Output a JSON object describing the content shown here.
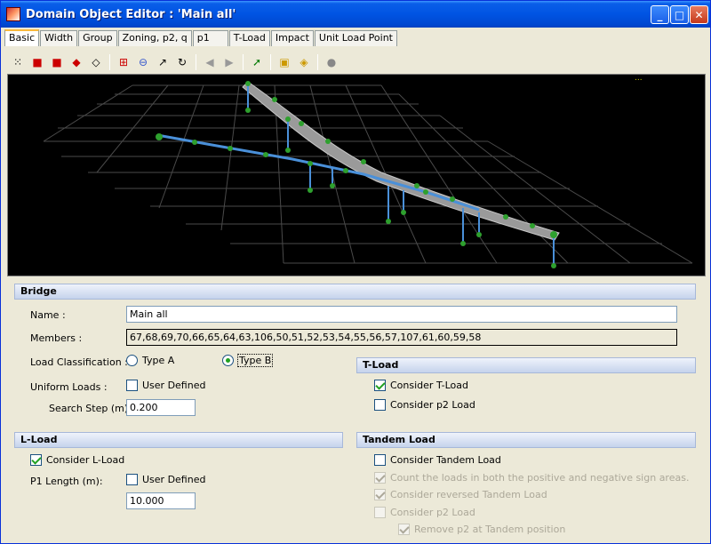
{
  "window": {
    "title": "Domain Object Editor : 'Main all'"
  },
  "tabs": [
    "Basic",
    "Width",
    "Group",
    "Zoning, p2, q",
    "p1",
    "T-Load",
    "Impact",
    "Unit Load Point"
  ],
  "toolbar": {
    "icons": [
      "select-all-icon",
      "cube-front-icon",
      "cube-side-icon",
      "cube-iso-icon",
      "wireframe-icon",
      "zoom-window-icon",
      "zoom-out-icon",
      "pan-arrow-icon",
      "rotate-icon",
      "back-icon",
      "forward-icon",
      "pointer-icon",
      "select-box-icon",
      "select-lasso-icon",
      "inspect-icon"
    ]
  },
  "viewport": {
    "indicator": "..."
  },
  "bridge": {
    "header": "Bridge",
    "name_label": "Name :",
    "name_value": "Main all",
    "members_label": "Members :",
    "members_value": "67,68,69,70,66,65,64,63,106,50,51,52,53,54,55,56,57,107,61,60,59,58",
    "load_class_label": "Load Classification :",
    "type_a": "Type A",
    "type_b": "Type B",
    "uniform_label": "Uniform Loads :",
    "uniform_user_defined": "User Defined",
    "search_step_label": "Search Step (m):",
    "search_step_value": "0.200"
  },
  "tload": {
    "header": "T-Load",
    "consider_tload": "Consider  T-Load",
    "consider_p2": "Consider p2 Load"
  },
  "lload": {
    "header": "L-Load",
    "consider_lload": "Consider L-Load",
    "p1_length_label": "P1 Length (m):",
    "p1_user_defined": "User Defined",
    "p1_length_value": "10.000"
  },
  "tandem": {
    "header": "Tandem Load",
    "consider_tandem": "Consider Tandem Load",
    "count_both": "Count the loads in both the positive and negative sign areas.",
    "consider_reversed": "Consider reversed Tandem Load",
    "consider_p2": "Consider p2 Load",
    "remove_p2": "Remove p2 at Tandem position"
  }
}
